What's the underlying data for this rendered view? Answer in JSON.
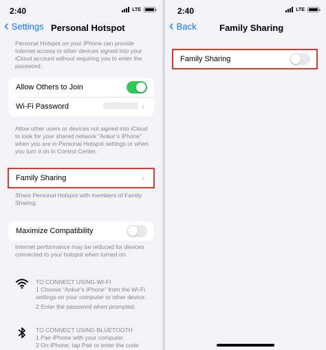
{
  "left": {
    "status": {
      "time": "2:40",
      "network": "LTE"
    },
    "nav": {
      "back_label": "Settings",
      "title": "Personal Hotspot"
    },
    "intro_note": "Personal Hotspot on your iPhone can provide Internet access to other devices signed into your iCloud account without requiring you to enter the password.",
    "allow_others": {
      "label": "Allow Others to Join",
      "enabled": true
    },
    "wifi_password": {
      "label": "Wi-Fi Password"
    },
    "icloud_note": "Allow other users or devices not signed into iCloud to look for your shared network “Ankur’s iPhone” when you are in Personal Hotspot settings or when you turn it on in Control Center.",
    "family_sharing": {
      "label": "Family Sharing"
    },
    "family_note": "Share Personal Hotspot with members of Family Sharing.",
    "maximize": {
      "label": "Maximize Compatibility",
      "enabled": false
    },
    "maximize_note": "Internet performance may be reduced for devices connected to your hotspot when turned on.",
    "wifi_instructions": {
      "icon": "wifi-icon",
      "heading": "TO CONNECT USING WI-FI",
      "step1": "1 Choose “Ankur’s iPhone” from the Wi-Fi settings on your computer or other device.",
      "step2": "2 Enter the password when prompted."
    },
    "bluetooth_instructions": {
      "icon": "bluetooth-icon",
      "heading": "TO CONNECT USING BLUETOOTH",
      "step1": "1 Pair iPhone with your computer.",
      "step2": "2 On iPhone, tap Pair or enter the code"
    }
  },
  "right": {
    "status": {
      "time": "2:40",
      "network": "LTE"
    },
    "nav": {
      "back_label": "Back",
      "title": "Family Sharing"
    },
    "family_sharing": {
      "label": "Family Sharing",
      "enabled": false
    }
  },
  "colors": {
    "accent": "#0a7aff",
    "toggle_on": "#34c759",
    "highlight": "#d93a2b",
    "background": "#f2f2f7"
  }
}
